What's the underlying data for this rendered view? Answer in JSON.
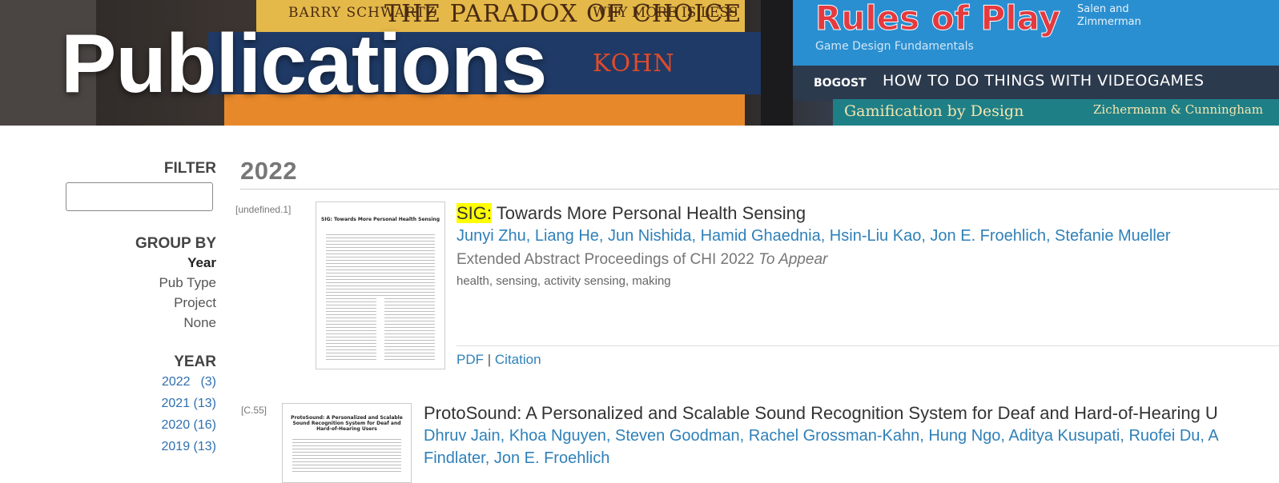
{
  "banner": {
    "title": "Publications",
    "books": {
      "paradox_author": "BARRY SCHWARTZ",
      "paradox_title": "THE PARADOX OF CHOICE",
      "paradox_sub": "WHY MORE IS LESS",
      "kohn": "KOHN",
      "rules_title": "Rules of Play",
      "rules_sub": "Game Design Fundamentals",
      "rules_authors": "Salen and Zimmerman",
      "bogost": "BOGOST",
      "bogost_title": "HOW TO DO THINGS WITH VIDEOGAMES",
      "gam_title": "Gamification by Design",
      "gam_authors": "Zichermann & Cunningham"
    }
  },
  "sidebar": {
    "filter_label": "FILTER",
    "filter_value": "",
    "group_by_label": "GROUP BY",
    "group_options": [
      "Year",
      "Pub Type",
      "Project",
      "None"
    ],
    "year_label": "YEAR",
    "years": [
      {
        "year": "2022",
        "count": "(3)"
      },
      {
        "year": "2021",
        "count": "(13)"
      },
      {
        "year": "2020",
        "count": "(16)"
      },
      {
        "year": "2019",
        "count": "(13)"
      }
    ]
  },
  "main": {
    "year_heading": "2022",
    "publications": [
      {
        "id": "[undefined.1]",
        "thumb_title": "SIG: Towards More Personal Health Sensing",
        "badge": "SIG:",
        "title": "Towards More Personal Health Sensing",
        "authors": "Junyi Zhu, Liang He, Jun Nishida, Hamid Ghaednia, Hsin-Liu Kao, Jon E. Froehlich, Stefanie Mueller",
        "venue": "Extended Abstract Proceedings of CHI 2022",
        "status": "To Appear",
        "keywords": "health, sensing, activity sensing, making",
        "pdf_label": "PDF",
        "separator": "|",
        "citation_label": "Citation"
      },
      {
        "id": "[C.55]",
        "thumb_title": "ProtoSound: A Personalized and Scalable Sound Recognition System for Deaf and Hard-of-Hearing Users",
        "title": "ProtoSound: A Personalized and Scalable Sound Recognition System for Deaf and Hard-of-Hearing U",
        "authors_line1": "Dhruv Jain, Khoa Nguyen, Steven Goodman, Rachel Grossman-Kahn, Hung Ngo, Aditya Kusupati, Ruofei Du, A",
        "authors_line2": "Findlater, Jon E. Froehlich"
      }
    ]
  }
}
